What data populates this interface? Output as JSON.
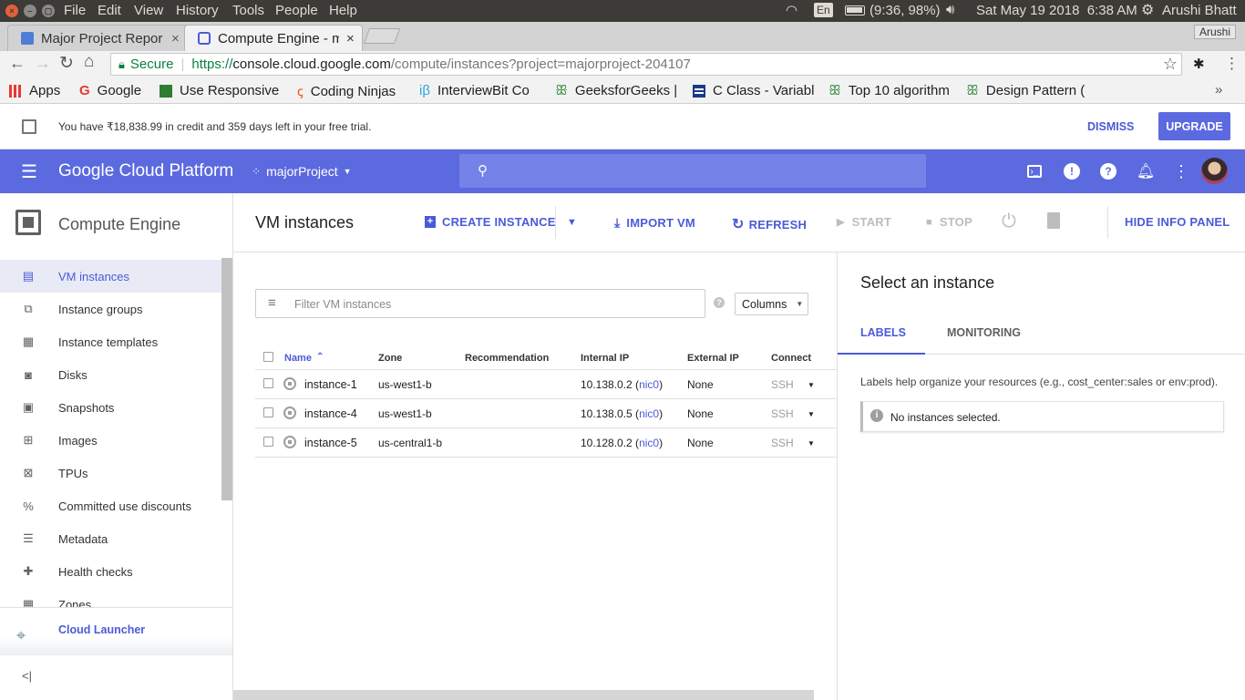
{
  "os": {
    "menus": [
      "File",
      "Edit",
      "View",
      "History",
      "Tools",
      "People",
      "Help"
    ],
    "lang": "En",
    "battery": "(9:36, 98%)",
    "datetime": "Sat May 19 2018  6:38 AM",
    "user": "Arushi Bhatt"
  },
  "browser": {
    "tabs": [
      {
        "title": "Major Project Repor",
        "close": "×"
      },
      {
        "title": "Compute Engine - m",
        "close": "×"
      }
    ],
    "profile": "Arushi",
    "secure_label": "Secure",
    "url_scheme": "https://",
    "url_host": "console.cloud.google.com",
    "url_path": "/compute/instances?project=majorproject-204107",
    "bookmarks": [
      "Apps",
      "Google",
      "Use Responsive",
      "Coding Ninjas",
      "InterviewBit Co",
      "GeeksforGeeks |",
      "C Class - Variabl",
      "Top 10 algorithm",
      "Design Pattern ("
    ],
    "more": "»"
  },
  "banner": {
    "text": "You have ₹18,838.99 in credit and 359 days left in your free trial.",
    "dismiss": "DISMISS",
    "upgrade": "UPGRADE"
  },
  "header": {
    "brand": "Google Cloud Platform",
    "project": "majorProject"
  },
  "sidebar": {
    "title": "Compute Engine",
    "items": [
      {
        "label": "VM instances",
        "active": true
      },
      {
        "label": "Instance groups"
      },
      {
        "label": "Instance templates"
      },
      {
        "label": "Disks"
      },
      {
        "label": "Snapshots"
      },
      {
        "label": "Images"
      },
      {
        "label": "TPUs"
      },
      {
        "label": "Committed use discounts"
      },
      {
        "label": "Metadata"
      },
      {
        "label": "Health checks"
      },
      {
        "label": "Zones"
      }
    ],
    "launcher": "Cloud Launcher",
    "collapse": "<|"
  },
  "toolbar": {
    "title": "VM instances",
    "create": "CREATE INSTANCE",
    "import": "IMPORT VM",
    "refresh": "REFRESH",
    "start": "START",
    "stop": "STOP",
    "hide_info": "HIDE INFO PANEL"
  },
  "filter": {
    "placeholder": "Filter VM instances",
    "columns": "Columns"
  },
  "table": {
    "headers": {
      "name": "Name",
      "zone": "Zone",
      "recommendation": "Recommendation",
      "internal_ip": "Internal IP",
      "external_ip": "External IP",
      "connect": "Connect"
    },
    "rows": [
      {
        "name": "instance-1",
        "zone": "us-west1-b",
        "ip": "10.138.0.2",
        "nic": "nic0",
        "ext": "None",
        "connect": "SSH"
      },
      {
        "name": "instance-4",
        "zone": "us-west1-b",
        "ip": "10.138.0.5",
        "nic": "nic0",
        "ext": "None",
        "connect": "SSH"
      },
      {
        "name": "instance-5",
        "zone": "us-central1-b",
        "ip": "10.128.0.2",
        "nic": "nic0",
        "ext": "None",
        "connect": "SSH"
      }
    ]
  },
  "info": {
    "title": "Select an instance",
    "tab_labels": "LABELS",
    "tab_monitoring": "MONITORING",
    "help": "Labels help organize your resources (e.g., cost_center:sales or env:prod).",
    "empty": "No instances selected."
  },
  "colors": {
    "accent": "#5c6ae0",
    "link": "#4a5bd8"
  }
}
